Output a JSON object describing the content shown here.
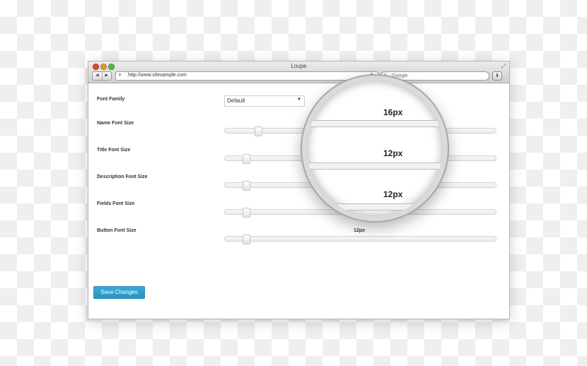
{
  "window": {
    "title": "Loupe",
    "address": "http://www.sitexample.com",
    "search_placeholder": "Google",
    "nav_back": "◀",
    "nav_forward": "▶"
  },
  "form": {
    "font_family_label": "Font Family",
    "font_family_value": "Default",
    "name_font_size_label": "Name Font Size",
    "title_font_size_label": "Title Font Size",
    "description_font_size_label": "Description Font Size",
    "fields_font_size_label": "Fields Font Size",
    "button_font_size_label": "Button Font Size",
    "button_font_size_value": "12px",
    "save_label": "Save Changes"
  },
  "loupe": {
    "name_value": "16px",
    "title_value": "12px",
    "description_value": "12px"
  },
  "colors": {
    "accent": "#2a93c1"
  }
}
